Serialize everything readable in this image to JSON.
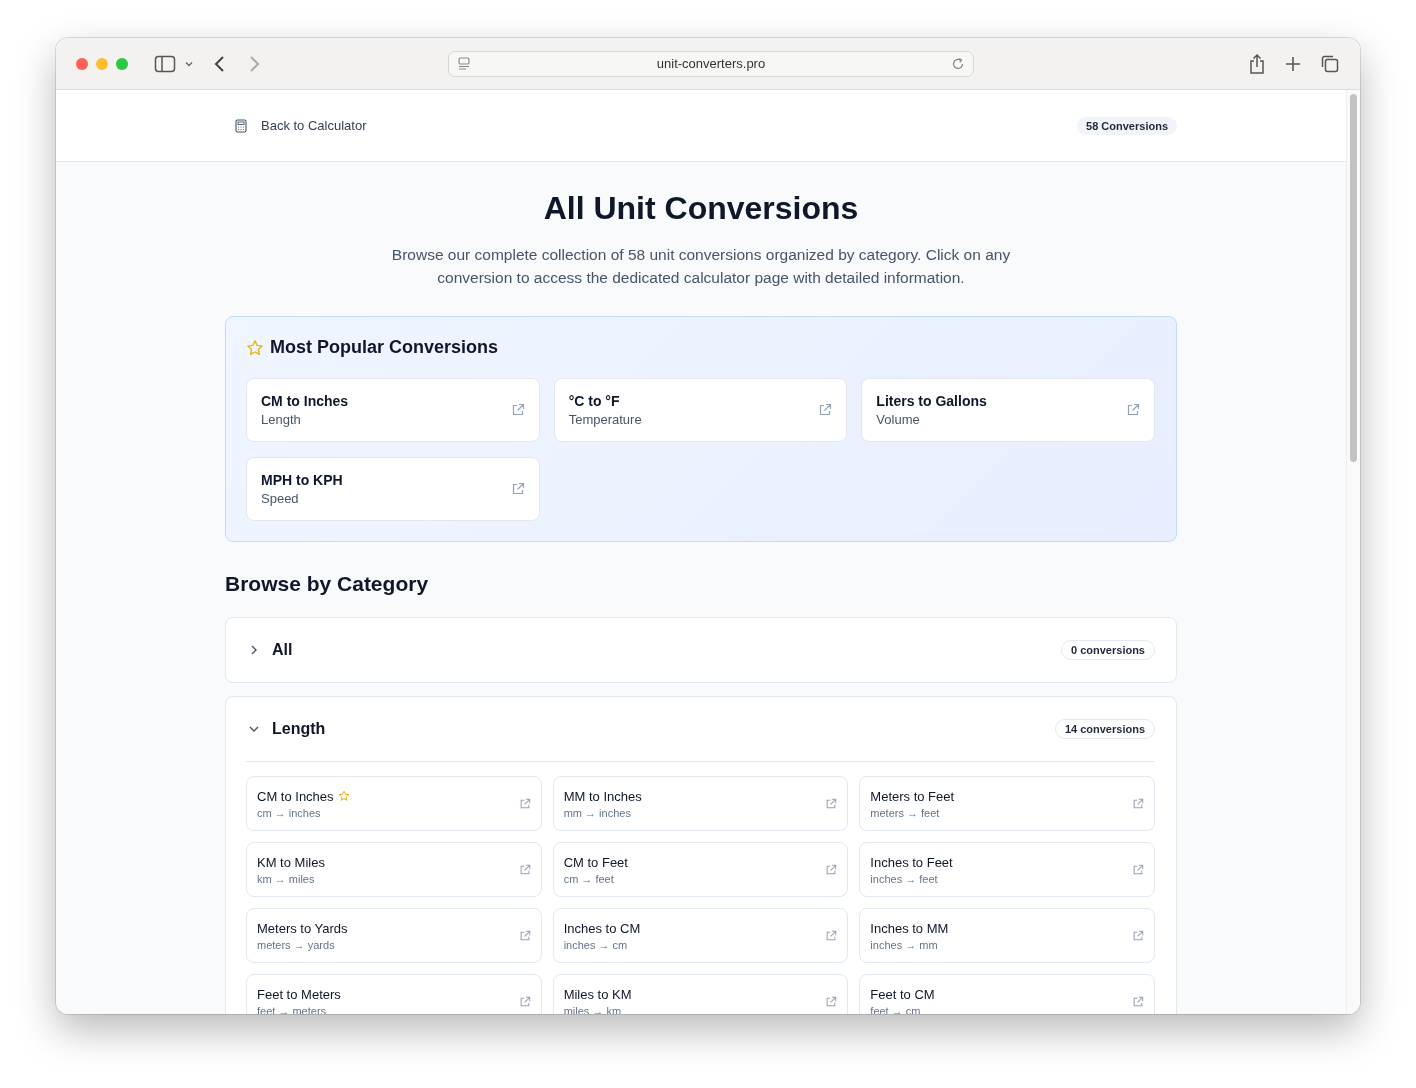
{
  "browser": {
    "url": "unit-converters.pro"
  },
  "header": {
    "back_link": "Back to Calculator",
    "count_badge": "58 Conversions"
  },
  "title": "All Unit Conversions",
  "description": "Browse our complete collection of 58 unit conversions organized by category. Click on any conversion to access the dedicated calculator page with detailed information.",
  "popular": {
    "heading": "Most Popular Conversions",
    "items": [
      {
        "name": "CM to Inches",
        "category": "Length"
      },
      {
        "name": "°C to °F",
        "category": "Temperature"
      },
      {
        "name": "Liters to Gallons",
        "category": "Volume"
      },
      {
        "name": "MPH to KPH",
        "category": "Speed"
      }
    ]
  },
  "browse_heading": "Browse by Category",
  "categories": [
    {
      "name": "All",
      "count": "0 conversions",
      "expanded": false
    },
    {
      "name": "Length",
      "count": "14 conversions",
      "expanded": true,
      "items": [
        {
          "name": "CM to Inches",
          "units": "cm → inches",
          "popular": true
        },
        {
          "name": "MM to Inches",
          "units": "mm → inches",
          "popular": false
        },
        {
          "name": "Meters to Feet",
          "units": "meters → feet",
          "popular": false
        },
        {
          "name": "KM to Miles",
          "units": "km → miles",
          "popular": false
        },
        {
          "name": "CM to Feet",
          "units": "cm → feet",
          "popular": false
        },
        {
          "name": "Inches to Feet",
          "units": "inches → feet",
          "popular": false
        },
        {
          "name": "Meters to Yards",
          "units": "meters → yards",
          "popular": false
        },
        {
          "name": "Inches to CM",
          "units": "inches → cm",
          "popular": false
        },
        {
          "name": "Inches to MM",
          "units": "inches → mm",
          "popular": false
        },
        {
          "name": "Feet to Meters",
          "units": "feet → meters",
          "popular": false
        },
        {
          "name": "Miles to KM",
          "units": "miles → km",
          "popular": false
        },
        {
          "name": "Feet to CM",
          "units": "feet → cm",
          "popular": false
        }
      ]
    }
  ]
}
